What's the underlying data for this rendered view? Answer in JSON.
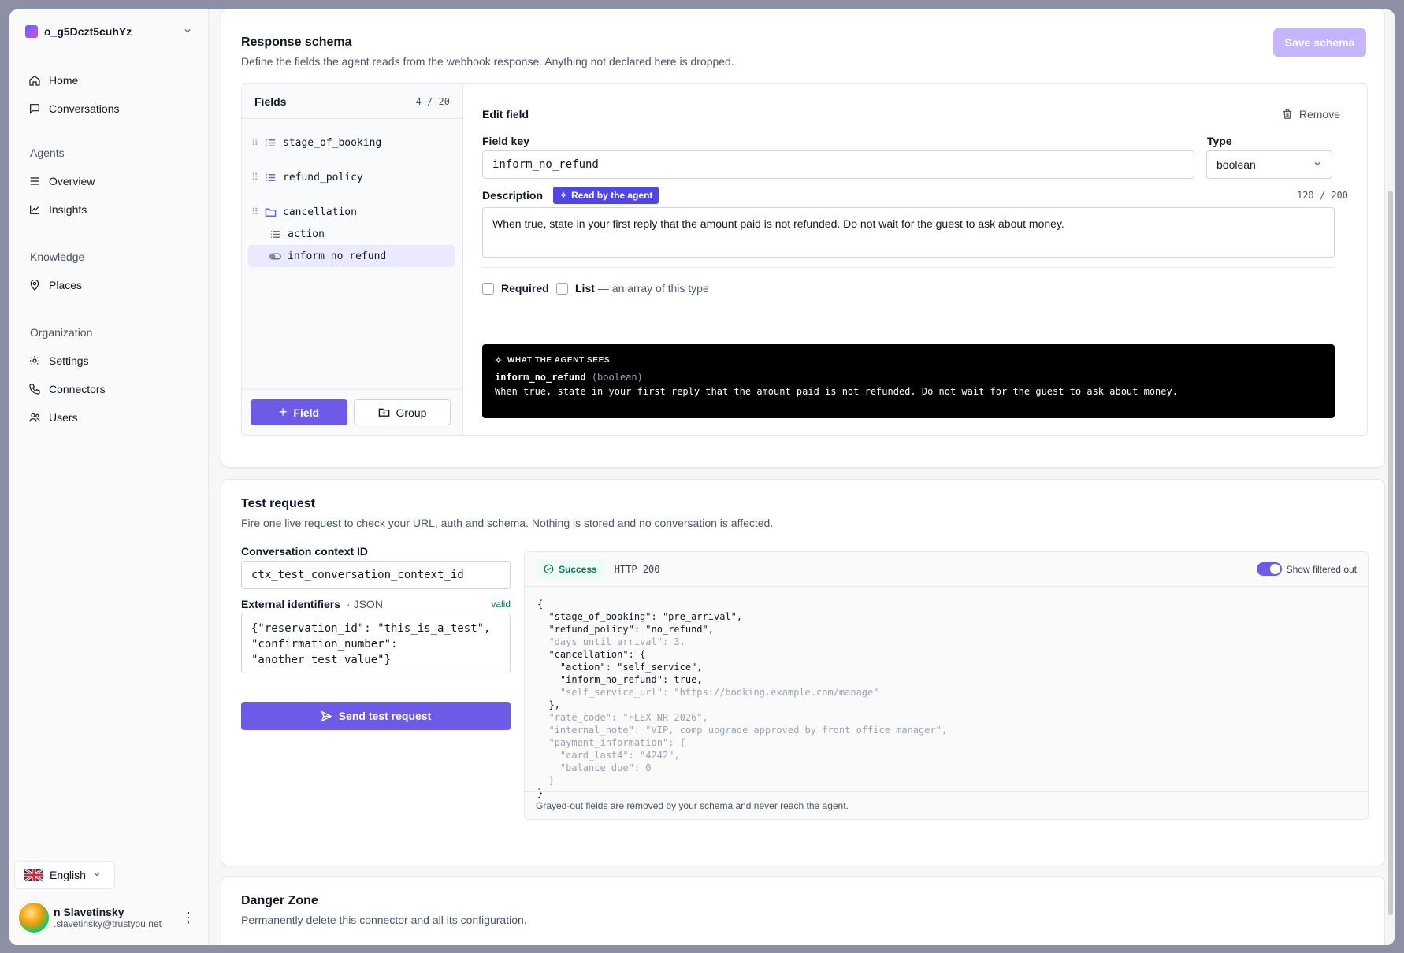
{
  "sidebar": {
    "org_name": "o_g5Dczt5cuhYz",
    "items_top": [
      {
        "label": "Home",
        "icon": "home-icon"
      },
      {
        "label": "Conversations",
        "icon": "message-icon"
      }
    ],
    "sections": [
      {
        "title": "Agents",
        "items": [
          {
            "label": "Overview",
            "icon": "list-icon"
          },
          {
            "label": "Insights",
            "icon": "chart-icon"
          }
        ]
      },
      {
        "title": "Knowledge",
        "items": [
          {
            "label": "Places",
            "icon": "map-pin-icon"
          }
        ]
      },
      {
        "title": "Organization",
        "items": [
          {
            "label": "Settings",
            "icon": "gear-icon"
          },
          {
            "label": "Connectors",
            "icon": "phone-icon"
          },
          {
            "label": "Users",
            "icon": "users-icon"
          }
        ]
      }
    ],
    "language": "English",
    "user": {
      "name": "n Slavetinsky",
      "email": ".slavetinsky@trustyou.net"
    }
  },
  "response_schema": {
    "title": "Response schema",
    "subtitle": "Define the fields the agent reads from the webhook response. Anything not declared here is dropped.",
    "save_label": "Save schema",
    "fields": {
      "title": "Fields",
      "count": "4 / 20",
      "items": [
        {
          "key": "stage_of_booking"
        },
        {
          "key": "refund_policy"
        },
        {
          "key": "cancellation"
        },
        {
          "key": "action"
        },
        {
          "key": "inform_no_refund"
        }
      ],
      "add_field_label": "Field",
      "add_group_label": "Group"
    },
    "edit": {
      "title": "Edit field",
      "remove_label": "Remove",
      "field_key_label": "Field key",
      "field_key_value": "inform_no_refund",
      "type_label": "Type",
      "type_value": "boolean",
      "description_label": "Description",
      "agent_badge": "Read by the agent",
      "char_count": "120 / 200",
      "description_value": "When true, state in your first reply that the amount paid is not refunded. Do not wait for the guest to ask about money.",
      "required_label": "Required",
      "list_label": "List",
      "list_hint": "— an array of this type",
      "preview_header": "WHAT THE AGENT SEES",
      "preview_key": "inform_no_refund",
      "preview_type": "(boolean)",
      "preview_desc": "When true, state in your first reply that the amount paid is not refunded. Do not wait for the guest to ask about money."
    }
  },
  "test_request": {
    "title": "Test request",
    "subtitle": "Fire one live request to check your URL, auth and schema. Nothing is stored and no conversation is affected.",
    "context_label": "Conversation context ID",
    "context_value": "ctx_test_conversation_context_id",
    "ext_label": "External identifiers",
    "ext_hint": "· JSON",
    "ext_valid": "valid",
    "ext_value": "{\"reservation_id\": \"this_is_a_test\",\n\"confirmation_number\":\n\"another_test_value\"}",
    "send_label": "Send test request",
    "status": "Success",
    "http": "HTTP 200",
    "toggle_label": "Show filtered out",
    "footer_note": "Grayed-out fields are removed by your schema and never reach the agent.",
    "response_lines": [
      {
        "text": "{",
        "dim": false
      },
      {
        "text": "  \"stage_of_booking\": \"pre_arrival\",",
        "dim": false
      },
      {
        "text": "  \"refund_policy\": \"no_refund\",",
        "dim": false
      },
      {
        "text": "  \"days_until_arrival\": 3,",
        "dim": true
      },
      {
        "text": "  \"cancellation\": {",
        "dim": false
      },
      {
        "text": "    \"action\": \"self_service\",",
        "dim": false
      },
      {
        "text": "    \"inform_no_refund\": true,",
        "dim": false
      },
      {
        "text": "    \"self_service_url\": \"https://booking.example.com/manage\"",
        "dim": true
      },
      {
        "text": "  },",
        "dim": false
      },
      {
        "text": "  \"rate_code\": \"FLEX-NR-2026\",",
        "dim": true
      },
      {
        "text": "  \"internal_note\": \"VIP, comp upgrade approved by front office manager\",",
        "dim": true
      },
      {
        "text": "  \"payment_information\": {",
        "dim": true
      },
      {
        "text": "    \"card_last4\": \"4242\",",
        "dim": true
      },
      {
        "text": "    \"balance_due\": 0",
        "dim": true
      },
      {
        "text": "  }",
        "dim": true
      },
      {
        "text": "}",
        "dim": false
      }
    ]
  },
  "danger_zone": {
    "title": "Danger Zone",
    "subtitle": "Permanently delete this connector and all its configuration."
  },
  "colors": {
    "accent": "#6d5ae6",
    "accent_disabled": "#c4b5fd",
    "success": "#047857",
    "agent_badge": "#4f46e5"
  }
}
